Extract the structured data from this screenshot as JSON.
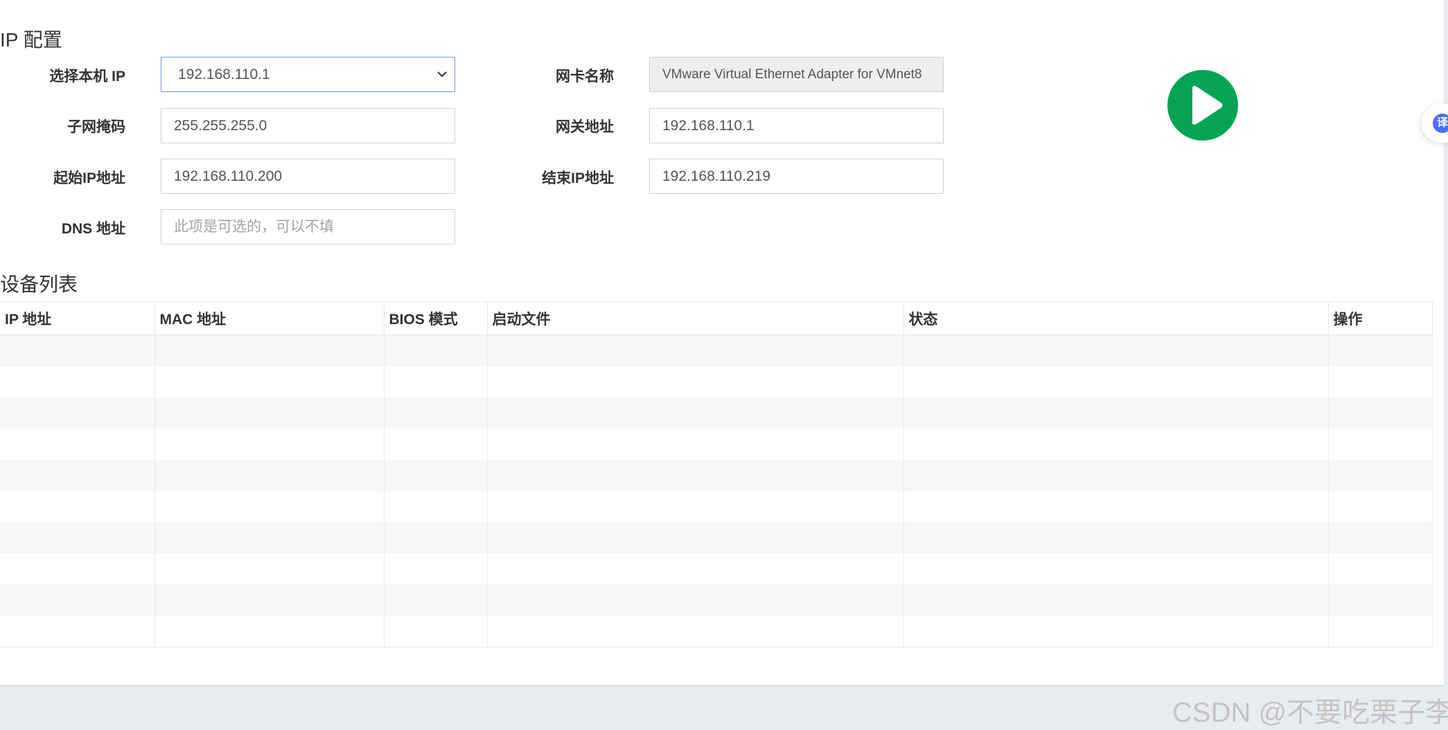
{
  "ip_config": {
    "title": "IP 配置",
    "fields": {
      "local_ip": {
        "label": "选择本机 IP",
        "value": "192.168.110.1"
      },
      "subnet_mask": {
        "label": "子网掩码",
        "value": "255.255.255.0"
      },
      "start_ip": {
        "label": "起始IP地址",
        "value": "192.168.110.200"
      },
      "dns": {
        "label": "DNS 地址",
        "placeholder": "此项是可选的，可以不填"
      },
      "nic_name": {
        "label": "网卡名称",
        "value": "VMware Virtual Ethernet Adapter for VMnet8"
      },
      "gateway": {
        "label": "网关地址",
        "value": "192.168.110.1"
      },
      "end_ip": {
        "label": "结束IP地址",
        "value": "192.168.110.219"
      }
    },
    "start_button_icon": "play-icon",
    "start_button_color": "#06a355"
  },
  "device_list": {
    "title": "设备列表",
    "columns": [
      "IP 地址",
      "MAC 地址",
      "BIOS 模式",
      "启动文件",
      "状态",
      "操作"
    ],
    "rows": [
      [
        "",
        "",
        "",
        "",
        "",
        ""
      ],
      [
        "",
        "",
        "",
        "",
        "",
        ""
      ],
      [
        "",
        "",
        "",
        "",
        "",
        ""
      ],
      [
        "",
        "",
        "",
        "",
        "",
        ""
      ],
      [
        "",
        "",
        "",
        "",
        "",
        ""
      ],
      [
        "",
        "",
        "",
        "",
        "",
        ""
      ],
      [
        "",
        "",
        "",
        "",
        "",
        ""
      ],
      [
        "",
        "",
        "",
        "",
        "",
        ""
      ],
      [
        "",
        "",
        "",
        "",
        "",
        ""
      ],
      [
        "",
        "",
        "",
        "",
        "",
        ""
      ]
    ]
  },
  "side_widget": {
    "icon": "translate-icon",
    "badge_text": "译",
    "color": "#4c6ef5"
  },
  "watermark": "CSDN @不要吃栗子李"
}
